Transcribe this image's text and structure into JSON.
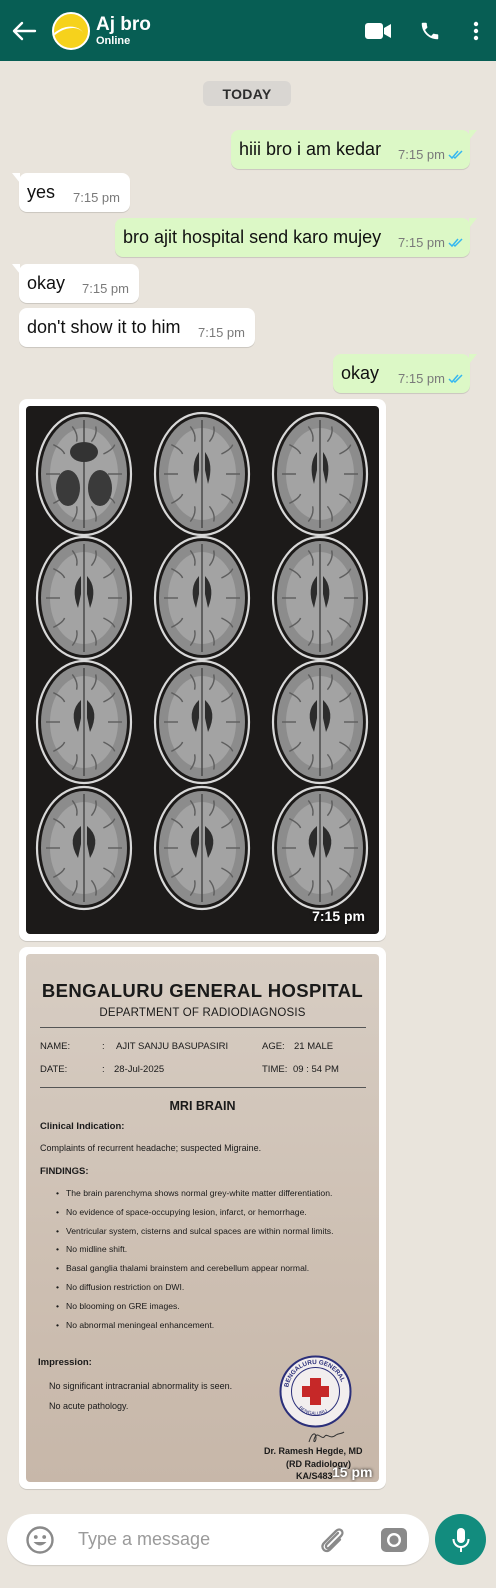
{
  "header": {
    "contact_name": "Aj bro",
    "status": "Online",
    "color": "#075e54"
  },
  "chat": {
    "day_label": "TODAY",
    "messages": [
      {
        "dir": "out",
        "text": "hiii bro i am kedar",
        "time": "7:15 pm",
        "read": true
      },
      {
        "dir": "in",
        "text": "yes",
        "time": "7:15 pm"
      },
      {
        "dir": "out",
        "text": "bro ajit hospital send karo mujey",
        "time": "7:15 pm",
        "read": true
      },
      {
        "dir": "in",
        "text": "okay",
        "time": "7:15 pm"
      },
      {
        "dir": "in",
        "text": "don't show it to him",
        "time": "7:15 pm"
      },
      {
        "dir": "out",
        "text": "okay",
        "time": "7:15 pm",
        "read": true
      }
    ],
    "image1": {
      "time": "7:15 pm"
    },
    "report": {
      "hospital": "BENGALURU  GENERAL HOSPITAL",
      "department": "DEPARTMENT OF RADIODIAGNOSIS",
      "name_label": "NAME:",
      "name_value": "AJIT SANJU BASUPASIRI",
      "age_label": "AGE:",
      "age_value": "21  MALE",
      "date_label": "DATE:",
      "date_value": "28-Jul-2025",
      "time_label": "TIME:",
      "time_value": "09 : 54    PM",
      "exam_title": "MRI BRAIN",
      "clinical_label": "Clinical Indication:",
      "clinical_text": "Complaints of recurrent headache; suspected Migraine.",
      "findings_label": "FINDINGS:",
      "findings": [
        "The brain parenchyma shows normal grey-white matter differentiation.",
        "No evidence of space-occupying lesion, infarct, or hemorrhage.",
        "Ventricular system, cisterns and sulcal spaces are within normal limits.",
        "No midline shift.",
        "Basal ganglia  thalami  brainstem  and cerebellum  appear normal.",
        "No diffusion restriction on DWI.",
        "No blooming on GRE images.",
        "No abnormal meningeal enhancement."
      ],
      "impression_label": "Impression:",
      "impression_1": "No significant intracranial abnormality is seen.",
      "impression_2": "No acute pathology.",
      "doctor_name": "Dr. Ramesh Hegde, MD",
      "doctor_title": "(RD  Radiology)",
      "doctor_reg": "KA/S483",
      "seal_text": "BENGALURU GENERAL",
      "seal_bottom": "BENGALURU",
      "message_time_fragment": "15 pm"
    }
  },
  "composer": {
    "placeholder": "Type a message"
  },
  "icons": {
    "back": "arrow-left-icon",
    "video": "video-call-icon",
    "call": "phone-icon",
    "menu": "more-vert-icon",
    "emoji": "emoji-icon",
    "attach": "paperclip-icon",
    "camera": "camera-icon",
    "mic": "mic-icon"
  }
}
